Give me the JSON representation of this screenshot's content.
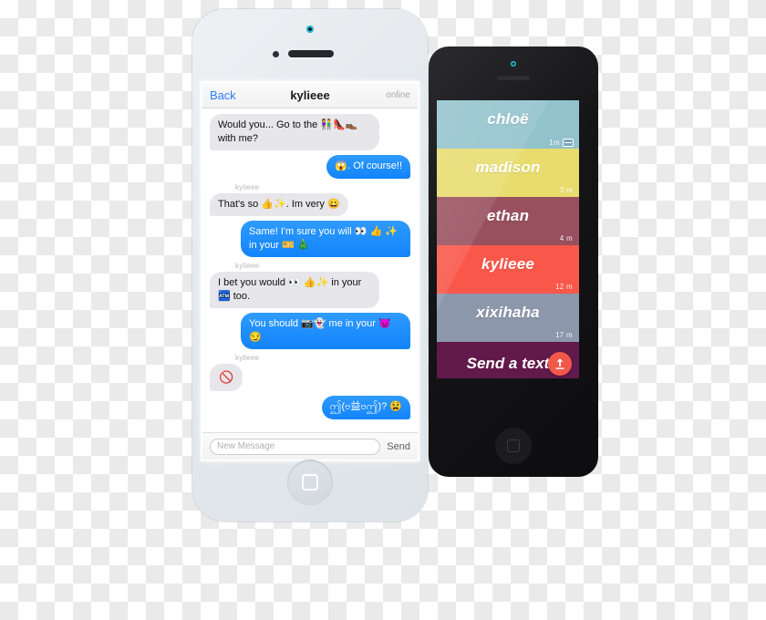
{
  "left_phone": {
    "device": "white-iphone",
    "navbar": {
      "back_label": "Back",
      "title": "kylieee",
      "status": "online"
    },
    "messages": [
      {
        "side": "in",
        "text": "Would you... Go to the 👫👠👞 with me?",
        "sender": null
      },
      {
        "side": "out",
        "text": "😱. Of course!!",
        "sender": null
      },
      {
        "side": "in",
        "text": "That's so 👍✨. Im very 😀",
        "sender": "kylieee"
      },
      {
        "side": "out",
        "text": "Same! I'm sure you will 👀 👍 ✨ in your 🎫 🎄",
        "sender": null
      },
      {
        "side": "in",
        "text": "I bet you would 👀 👍✨ in your 🏧 too.",
        "sender": "kylieee"
      },
      {
        "side": "out",
        "text": "You should 📷👻 me in your 👿 😏",
        "sender": null
      },
      {
        "side": "in",
        "text": "🚫",
        "sender": "kylieee"
      },
      {
        "side": "out",
        "text": "ဤ(ဗ益ဗဤ)? 😫",
        "sender": null
      }
    ],
    "composer": {
      "placeholder": "New Message",
      "value": "",
      "send_label": "Send"
    }
  },
  "right_phone": {
    "device": "black-iphone",
    "conversations": [
      {
        "name": "chloë",
        "time": "1m",
        "color": "#92c2cc",
        "has_badge": true,
        "badge_icon": "ticket-icon"
      },
      {
        "name": "madison",
        "time": "3 m",
        "color": "#e8dc6e",
        "has_badge": false,
        "badge_icon": null
      },
      {
        "name": "ethan",
        "time": "4 m",
        "color": "#99505e",
        "has_badge": false,
        "badge_icon": null
      },
      {
        "name": "kylieee",
        "time": "12 m",
        "color": "#f9574a",
        "has_badge": false,
        "badge_icon": null
      },
      {
        "name": "xixihaha",
        "time": "17 m",
        "color": "#8d97ab",
        "has_badge": false,
        "badge_icon": null
      }
    ],
    "send_a_text": {
      "label": "Send a text",
      "color": "#62194b",
      "footer_color": "#d0a3a6",
      "fab_icon": "upload-icon",
      "fab_color": "#f2584a"
    }
  },
  "theme": {
    "bubble_in_bg": "#e6e6eb",
    "bubble_out_bg": "#1283fb",
    "link_blue": "#2a7bf6",
    "background": "transparent-checkerboard"
  }
}
